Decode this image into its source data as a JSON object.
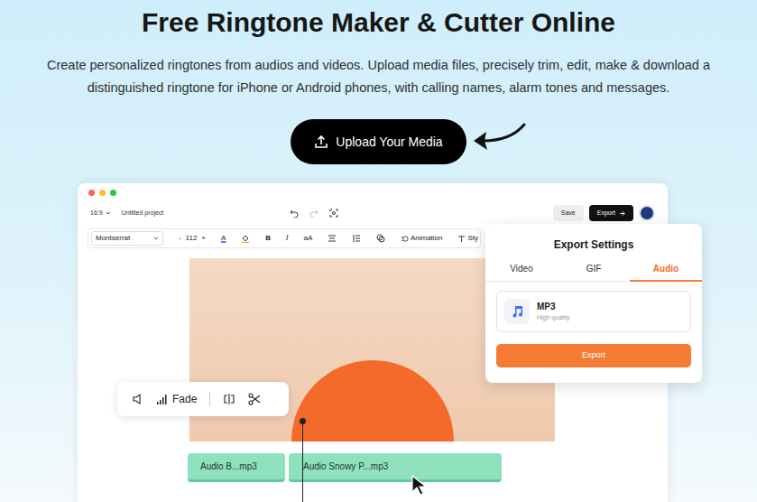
{
  "page": {
    "title": "Free Ringtone Maker & Cutter Online",
    "subtitle": "Create personalized ringtones from audios and videos. Upload media files, precisely trim, edit, make & download a distinguished ringtone for iPhone or Android phones, with calling names, alarm tones and messages.",
    "upload_button": "Upload Your Media"
  },
  "editor": {
    "aspect_ratio": "16:9",
    "project_name": "Untitled project",
    "save_button": "Save",
    "export_button": "Export",
    "toolbar": {
      "font": "Montserrat",
      "size_minus": "-",
      "font_size": "112",
      "size_plus": "+",
      "text_color": "A",
      "bold": "B",
      "italic": "I",
      "case": "aA",
      "animation": "Animation",
      "style": "Sty"
    }
  },
  "audio_toolbar": {
    "fade": "Fade"
  },
  "export_panel": {
    "title": "Export Settings",
    "tabs": [
      {
        "label": "Video",
        "selected": false
      },
      {
        "label": "GIF",
        "selected": false
      },
      {
        "label": "Audio",
        "selected": true
      }
    ],
    "format": "MP3",
    "quality": "High quality",
    "button": "Export"
  },
  "timeline": {
    "clips": [
      {
        "label": "Audio B...mp3"
      },
      {
        "label": "Audio Snowy P...mp3"
      }
    ]
  }
}
